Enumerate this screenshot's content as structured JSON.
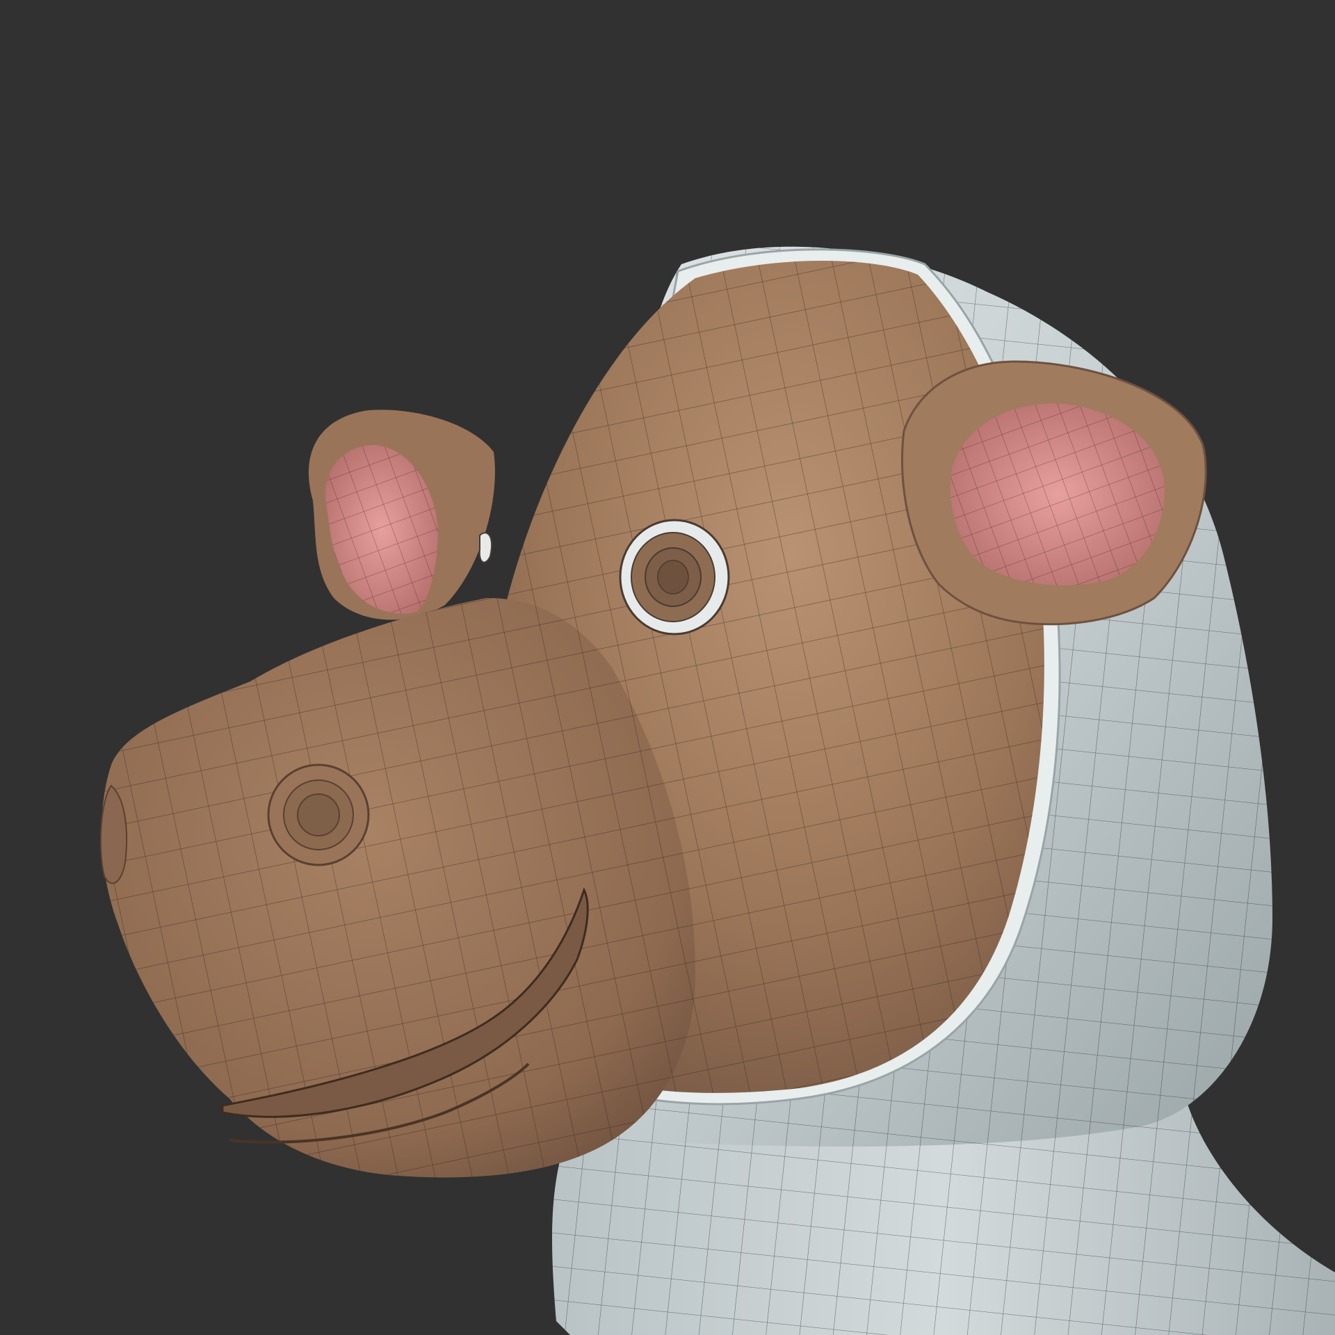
{
  "viewport": {
    "background_color": "#313131"
  },
  "model": {
    "subject": "hippo-head",
    "colors": {
      "head_skin": "#a07a5c",
      "head_highlight": "#b38e70",
      "head_shadow": "#6e5140",
      "ear_inner": "#d88c8c",
      "eye_ring": "#e6eaea",
      "hood": "#c9d1d3",
      "hood_shadow": "#8f999c",
      "wireframe": "#1a1410"
    }
  }
}
